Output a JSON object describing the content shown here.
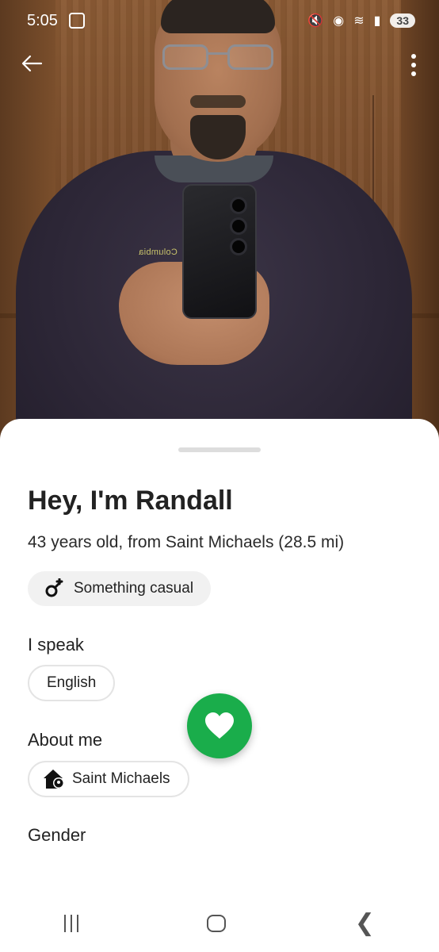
{
  "status_bar": {
    "time": "5:05",
    "battery": "33",
    "icons": [
      "screenshot-icon",
      "mute-icon",
      "location-icon",
      "wifi-icon",
      "signal-icon",
      "battery-icon"
    ]
  },
  "profile": {
    "greeting": "Hey, I'm Randall",
    "subtitle": "43 years old, from Saint Michaels (28.5 mi)",
    "intent": "Something casual",
    "languages_label": "I speak",
    "language": "English",
    "about_label": "About me",
    "location": "Saint Michaels",
    "gender_label": "Gender"
  },
  "actions": {
    "back_icon": "arrow-left-icon",
    "more_icon": "more-vertical-icon",
    "like_icon": "heart-icon"
  },
  "colors": {
    "accent": "#1aad4b",
    "chip_bg": "#f1f1f1",
    "text": "#222222"
  }
}
